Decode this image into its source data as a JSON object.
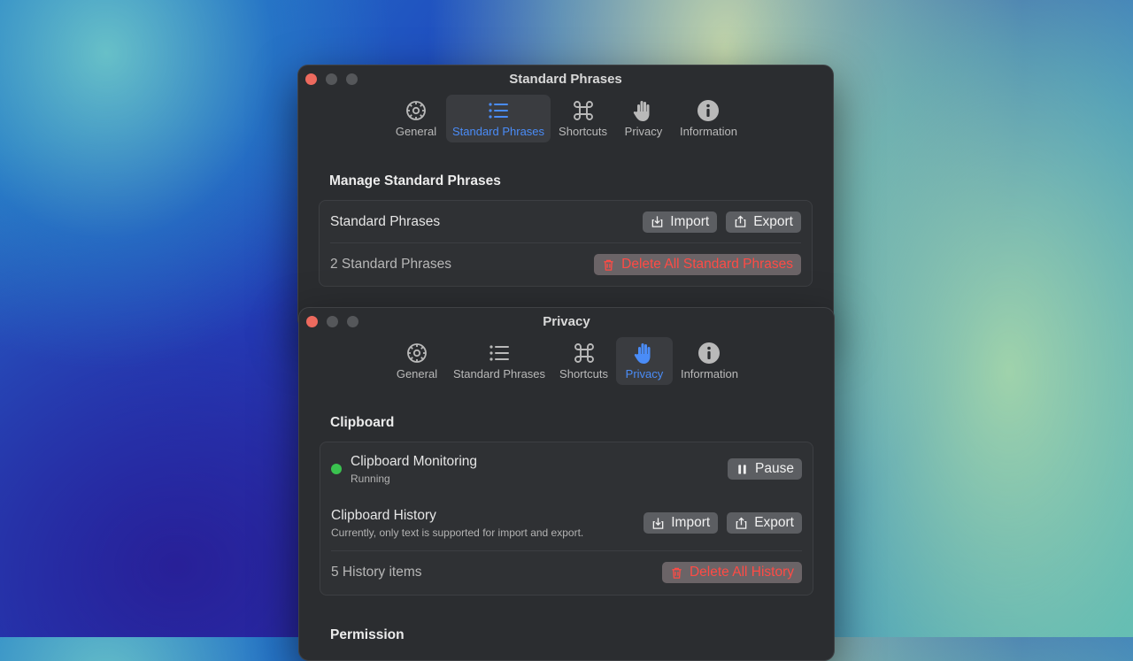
{
  "colors": {
    "accent": "#4a8cf7",
    "danger": "#ff4b45",
    "status_running": "#3ac24f",
    "close_button": "#ed6a5e"
  },
  "tab_labels": {
    "general": "General",
    "standard_phrases": "Standard Phrases",
    "shortcuts": "Shortcuts",
    "privacy": "Privacy",
    "information": "Information"
  },
  "icons": {
    "general": "gear-icon",
    "standard_phrases": "list-icon",
    "shortcuts": "command-icon",
    "privacy": "hand-icon",
    "information": "info-icon",
    "import": "import-icon",
    "export": "share-icon",
    "delete": "trash-icon",
    "pause": "pause-icon"
  },
  "phrases_window": {
    "title": "Standard Phrases",
    "active_tab": "Standard Phrases",
    "section_title": "Manage Standard Phrases",
    "row_label": "Standard Phrases",
    "import_label": "Import",
    "export_label": "Export",
    "count_text": "2 Standard Phrases",
    "delete_label": "Delete All Standard Phrases"
  },
  "privacy_window": {
    "title": "Privacy",
    "active_tab": "Privacy",
    "section_title": "Clipboard",
    "monitoring_label": "Clipboard Monitoring",
    "monitoring_status": "Running",
    "pause_label": "Pause",
    "history_label": "Clipboard History",
    "history_note": "Currently, only text is supported for import and export.",
    "import_label": "Import",
    "export_label": "Export",
    "count_text": "5 History items",
    "delete_label": "Delete All History",
    "next_section_title": "Permission"
  }
}
